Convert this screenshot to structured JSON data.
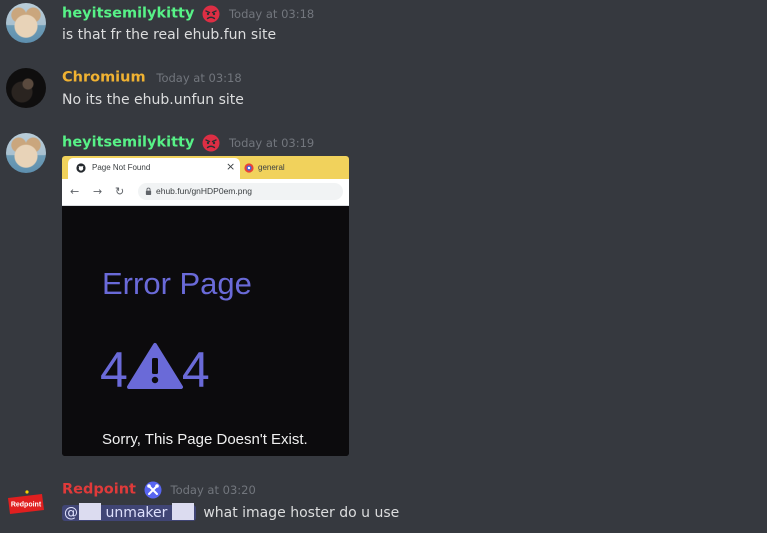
{
  "messages": [
    {
      "username": "heyitsemilykitty",
      "username_color": "#57f287",
      "timestamp": "Today at 03:18",
      "text": "is that fr the real ehub.fun site"
    },
    {
      "username": "Chromium",
      "username_color": "#f0b232",
      "timestamp": "Today at 03:18",
      "text": "No its the ehub.unfun site"
    },
    {
      "username": "heyitsemilykitty",
      "username_color": "#57f287",
      "timestamp": "Today at 03:19"
    },
    {
      "username": "Redpoint",
      "username_color": "#e03a3a",
      "timestamp": "Today at 03:20",
      "mention_prefix": "@",
      "mention_name": "unmaker",
      "text": "what image hoster do u use"
    }
  ],
  "avatar_badge_text": "Redpoint",
  "embed": {
    "tabs": [
      {
        "title": "Page Not Found"
      },
      {
        "title": "general"
      }
    ],
    "close_glyph": "×",
    "nav": {
      "back": "←",
      "forward": "→",
      "reload": "↻"
    },
    "url": "ehub.fun/gnHDP0em.png",
    "page": {
      "title": "Error Page",
      "code_left": "4",
      "code_right": "4",
      "message": "Sorry, This Page Doesn't Exist."
    }
  },
  "colors": {
    "background": "#36393f",
    "timestamp": "#72767d",
    "error_accent": "#6a6ad8"
  },
  "icons": {
    "angry_badge": "angry-face-emoji-icon",
    "bot_badge": "tools-icon",
    "warning": "warning-triangle-icon"
  }
}
